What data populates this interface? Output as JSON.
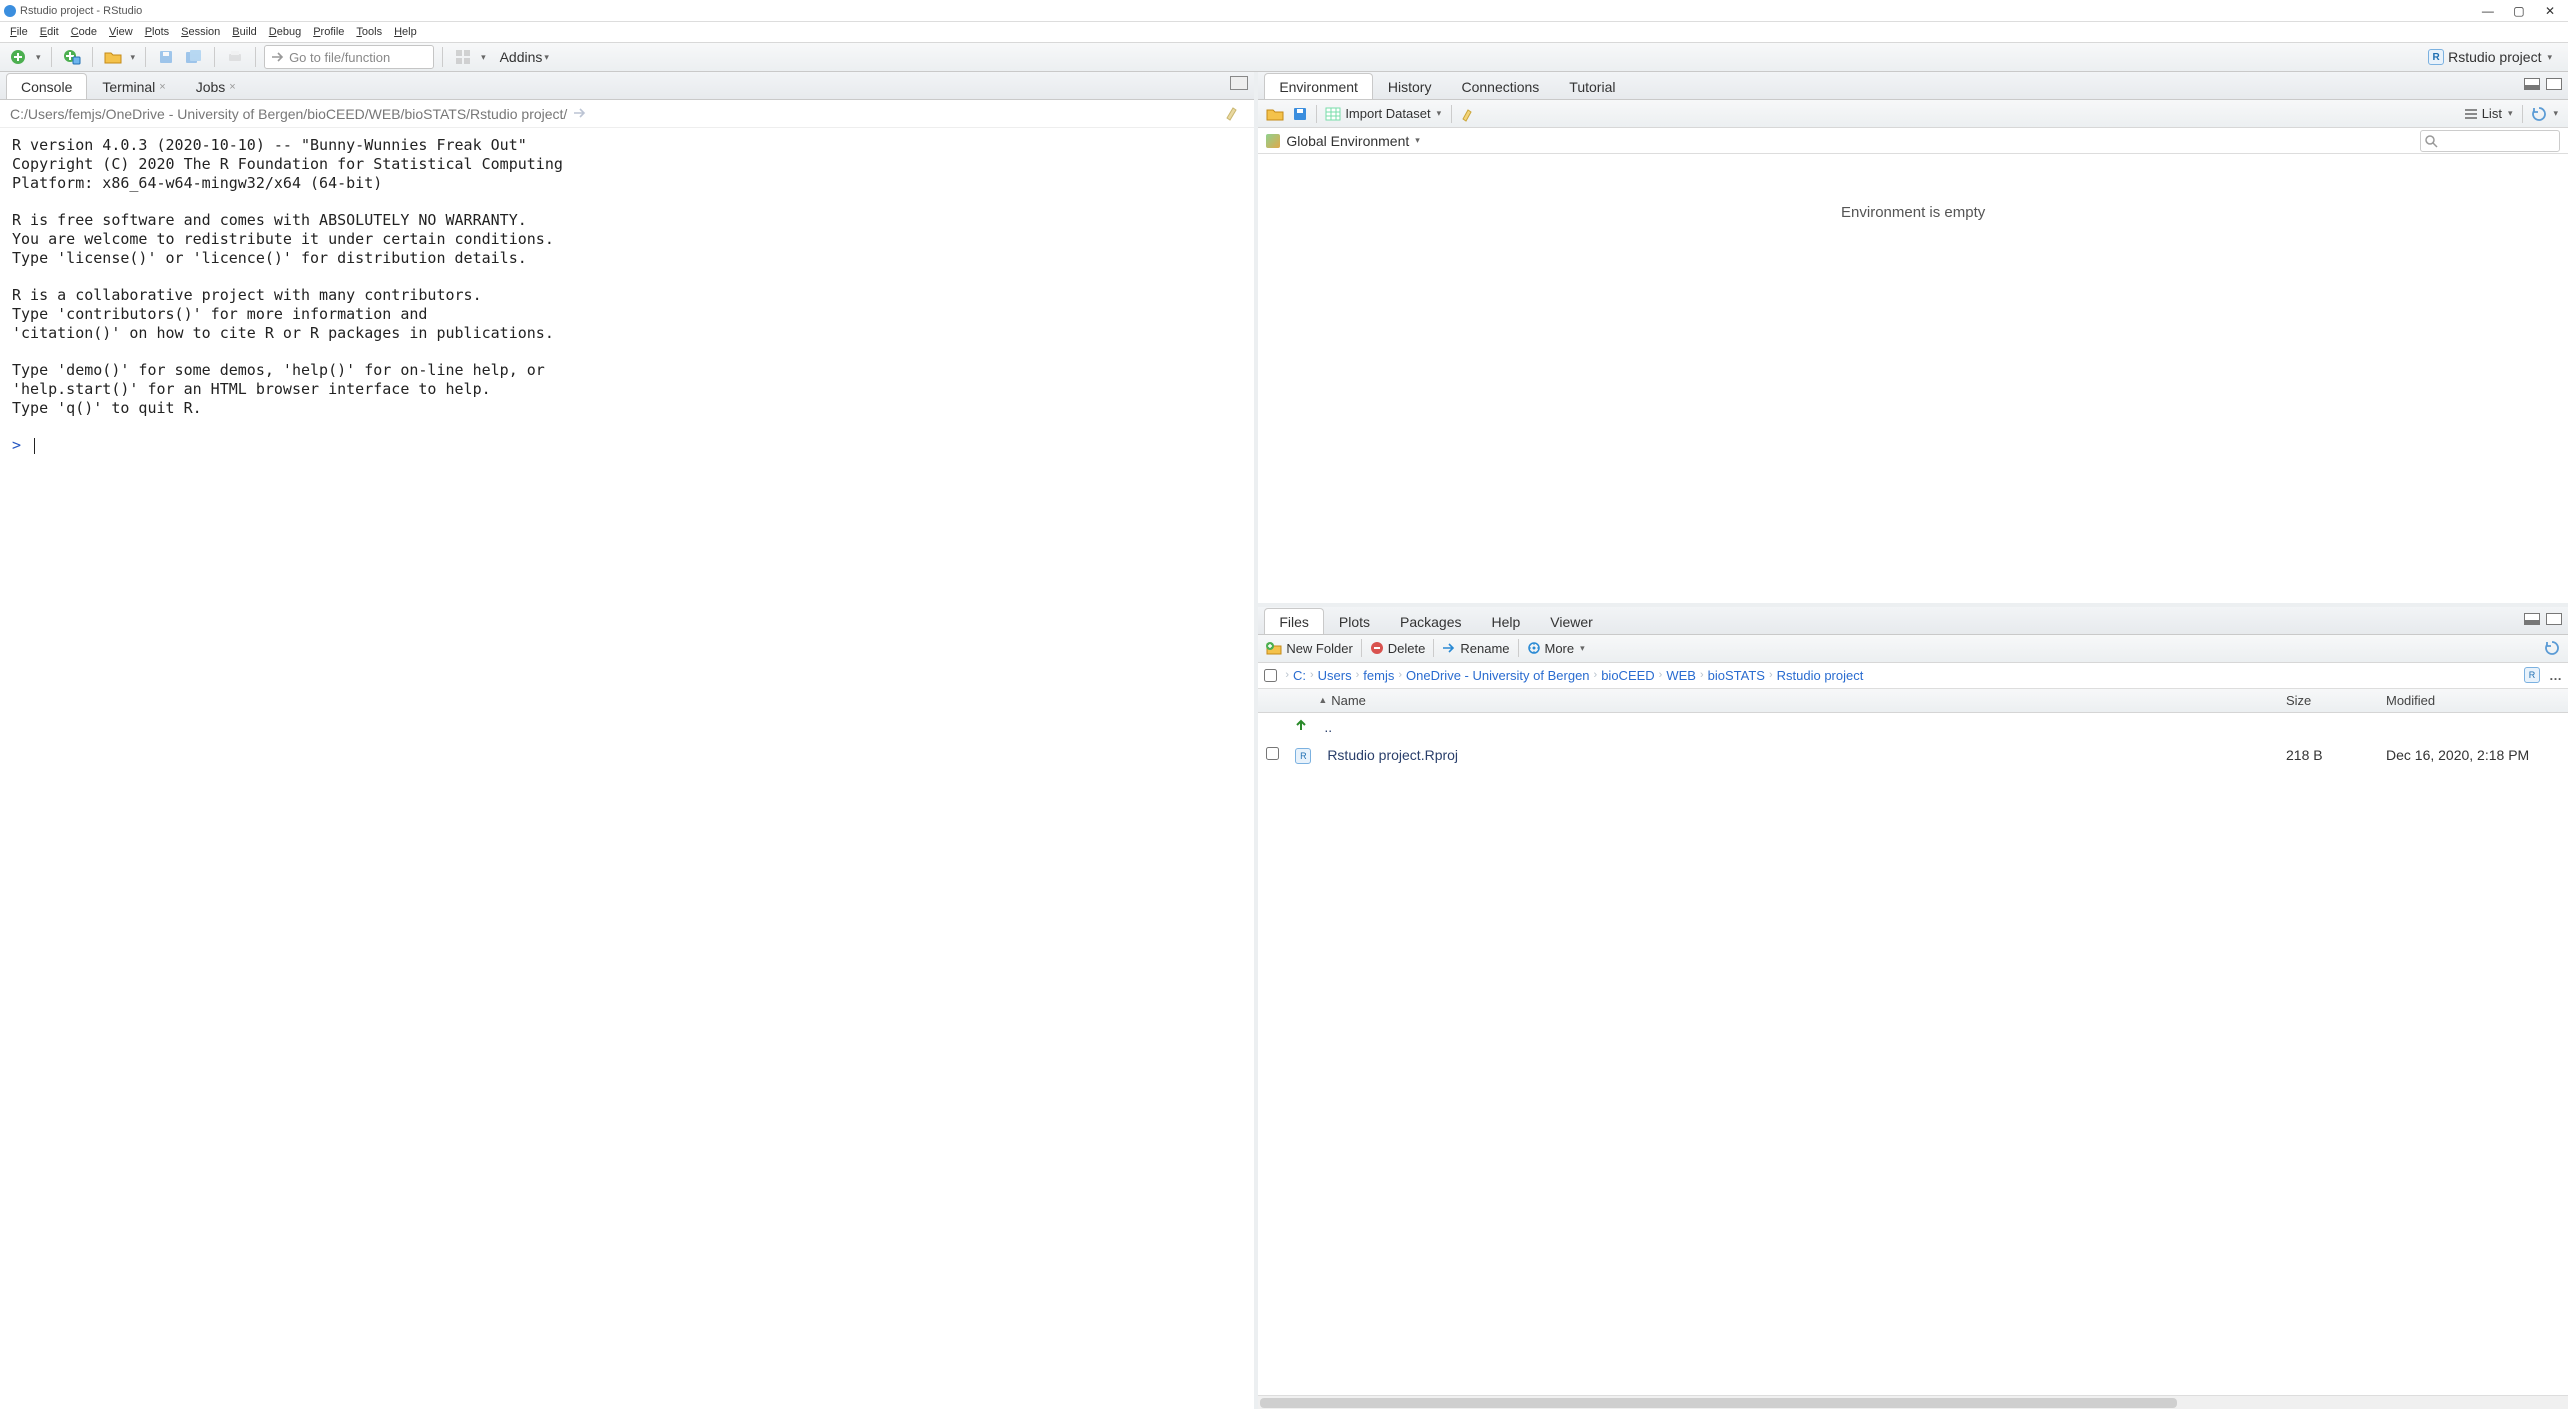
{
  "window": {
    "title": "Rstudio project - RStudio"
  },
  "menubar": [
    "File",
    "Edit",
    "Code",
    "View",
    "Plots",
    "Session",
    "Build",
    "Debug",
    "Profile",
    "Tools",
    "Help"
  ],
  "toolbar": {
    "goto_placeholder": "Go to file/function",
    "addins_label": "Addins",
    "project_label": "Rstudio project"
  },
  "console": {
    "tabs": [
      {
        "label": "Console",
        "active": true,
        "closable": false
      },
      {
        "label": "Terminal",
        "active": false,
        "closable": true
      },
      {
        "label": "Jobs",
        "active": false,
        "closable": true
      }
    ],
    "path": "C:/Users/femjs/OneDrive - University of Bergen/bioCEED/WEB/bioSTATS/Rstudio project/",
    "output": "R version 4.0.3 (2020-10-10) -- \"Bunny-Wunnies Freak Out\"\nCopyright (C) 2020 The R Foundation for Statistical Computing\nPlatform: x86_64-w64-mingw32/x64 (64-bit)\n\nR is free software and comes with ABSOLUTELY NO WARRANTY.\nYou are welcome to redistribute it under certain conditions.\nType 'license()' or 'licence()' for distribution details.\n\nR is a collaborative project with many contributors.\nType 'contributors()' for more information and\n'citation()' on how to cite R or R packages in publications.\n\nType 'demo()' for some demos, 'help()' for on-line help, or\n'help.start()' for an HTML browser interface to help.\nType 'q()' to quit R.\n",
    "prompt": ">"
  },
  "env": {
    "tabs": [
      "Environment",
      "History",
      "Connections",
      "Tutorial"
    ],
    "active_tab": "Environment",
    "import_label": "Import Dataset",
    "list_label": "List",
    "scope_label": "Global Environment",
    "empty_text": "Environment is empty"
  },
  "files": {
    "tabs": [
      "Files",
      "Plots",
      "Packages",
      "Help",
      "Viewer"
    ],
    "active_tab": "Files",
    "toolbar": {
      "new_folder": "New Folder",
      "delete": "Delete",
      "rename": "Rename",
      "more": "More"
    },
    "breadcrumb": [
      "C:",
      "Users",
      "femjs",
      "OneDrive - University of Bergen",
      "bioCEED",
      "WEB",
      "bioSTATS",
      "Rstudio project"
    ],
    "headers": {
      "name": "Name",
      "size": "Size",
      "modified": "Modified"
    },
    "updir": "..",
    "rows": [
      {
        "name": "Rstudio project.Rproj",
        "size": "218 B",
        "modified": "Dec 16, 2020, 2:18 PM"
      }
    ]
  }
}
